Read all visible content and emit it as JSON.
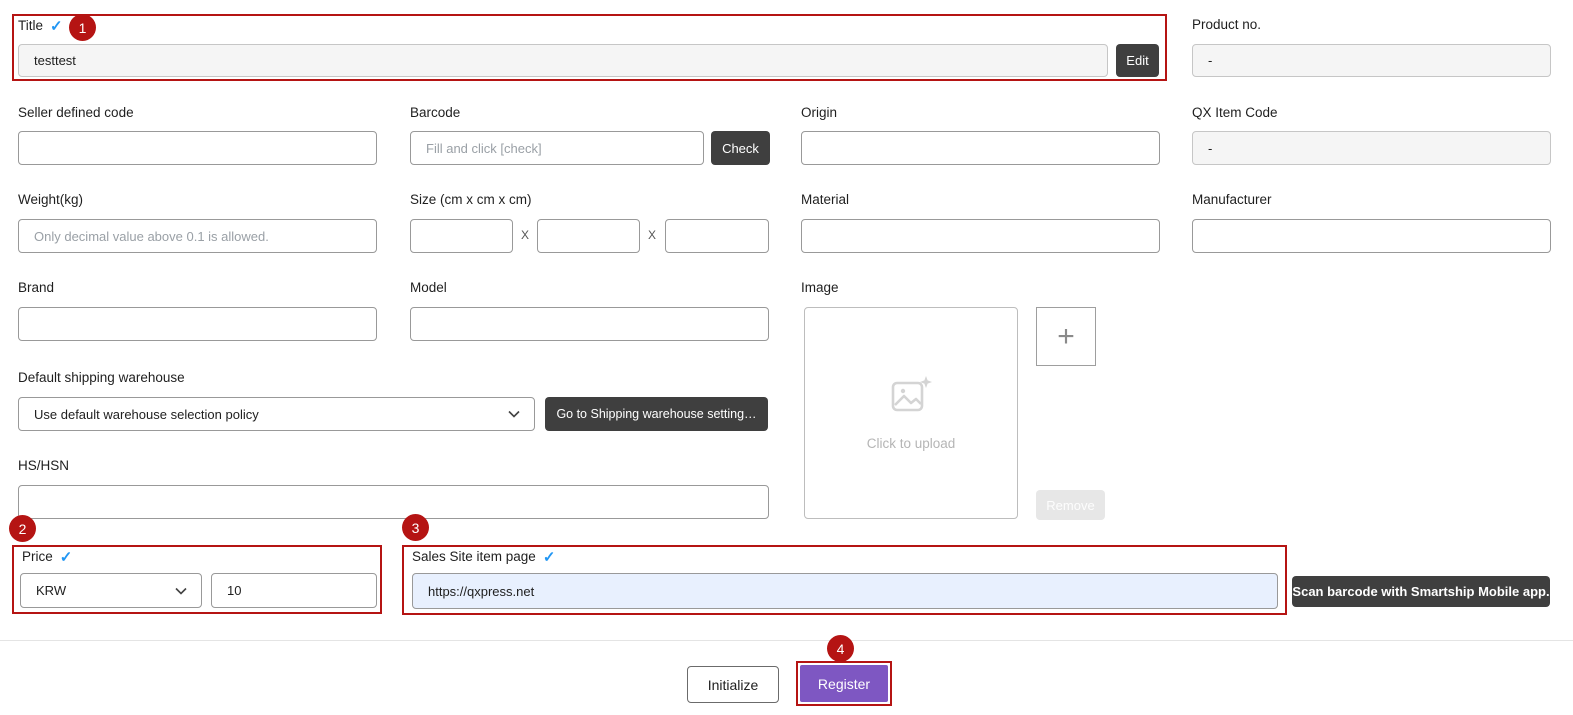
{
  "icons": {
    "check": "✓",
    "plus": "+"
  },
  "annotations": {
    "step1": "1",
    "step2": "2",
    "step3": "3",
    "step4": "4"
  },
  "colors": {
    "annotation_red": "#b51413",
    "dark_button": "#3f3f3f",
    "register_purple": "#7e57c2",
    "required_check_blue": "#2196f3",
    "readonly_bg": "#f5f5f5",
    "autofill_blue_bg": "#e8f0fe"
  },
  "form": {
    "title": {
      "label": "Title",
      "value": "testtest",
      "edit": "Edit"
    },
    "product_no": {
      "label": "Product no.",
      "value": "-"
    },
    "seller_code": {
      "label": "Seller defined code",
      "value": ""
    },
    "barcode": {
      "label": "Barcode",
      "placeholder": "Fill and click [check]",
      "check": "Check"
    },
    "origin": {
      "label": "Origin",
      "value": ""
    },
    "qx_item_code": {
      "label": "QX Item Code",
      "value": "-"
    },
    "weight": {
      "label": "Weight(kg)",
      "placeholder": "Only decimal value above 0.1 is allowed."
    },
    "size": {
      "label": "Size (cm x cm x cm)",
      "separator": "X"
    },
    "material": {
      "label": "Material",
      "value": ""
    },
    "manufacturer": {
      "label": "Manufacturer",
      "value": ""
    },
    "brand": {
      "label": "Brand",
      "value": ""
    },
    "model": {
      "label": "Model",
      "value": ""
    },
    "image": {
      "label": "Image",
      "upload": "Click to upload",
      "remove": "Remove"
    },
    "warehouse": {
      "label": "Default shipping warehouse",
      "selected": "Use default warehouse selection policy",
      "goto": "Go to Shipping warehouse setting…"
    },
    "hs_hsn": {
      "label": "HS/HSN",
      "value": ""
    },
    "price": {
      "label": "Price",
      "currency": "KRW",
      "amount": "10"
    },
    "sales_site": {
      "label": "Sales Site item page",
      "url": "https://qxpress.net"
    },
    "scan": "Scan barcode with Smartship Mobile app."
  },
  "footer": {
    "initialize": "Initialize",
    "register": "Register"
  }
}
